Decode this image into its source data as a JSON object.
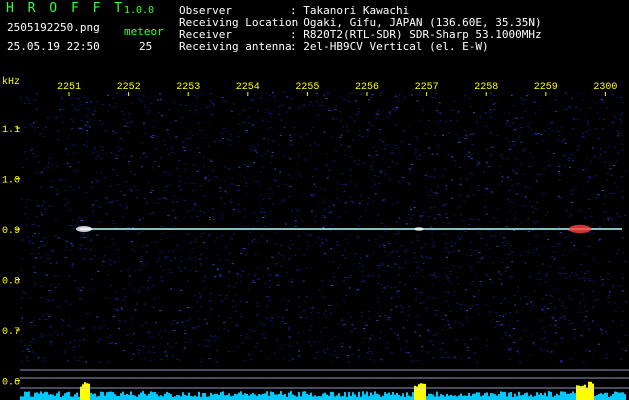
{
  "header": {
    "app_name": "H R O F F T",
    "version": "1.0.0",
    "filename": "2505192250.png",
    "datetime": "25.05.19 22:50",
    "meteor_label": "meteor",
    "meteor_count": "25"
  },
  "station": {
    "observer_label": "Observer",
    "observer_value": ": Takanori Kawachi",
    "location_label": "Receiving Location",
    "location_value": ": Ogaki, Gifu, JAPAN (136.60E, 35.35N)",
    "receiver_label": "Receiver",
    "receiver_value": ": R820T2(RTL-SDR) SDR-Sharp 53.1000MHz",
    "antenna_label": "Receiving antenna",
    "antenna_value": ": 2el-HB9CV Vertical (el. E-W)"
  },
  "axis": {
    "unit": "kHz",
    "time_ticks": [
      "2251",
      "2252",
      "2253",
      "2254",
      "2255",
      "2256",
      "2257",
      "2258",
      "2259",
      "2300"
    ],
    "freq_ticks": [
      "1.1",
      "1.0",
      "0.9",
      "0.8",
      "0.7",
      "0.6"
    ]
  },
  "colors": {
    "background": "#000000",
    "label_green": "#33ff33",
    "label_yellow": "#ffff00",
    "waterfall_noise": "#1a2bd0",
    "carrier": "#b0ffff",
    "meteor_peak": "#ff4040",
    "signal_bar": "#00c8ff"
  },
  "chart_data": {
    "type": "heatmap",
    "x_unit": "time (HHMM)",
    "y_unit": "kHz",
    "x_categories": [
      "2251",
      "2252",
      "2253",
      "2254",
      "2255",
      "2256",
      "2257",
      "2258",
      "2259",
      "2300"
    ],
    "y_ticks": [
      1.1,
      1.0,
      0.9,
      0.8,
      0.7,
      0.6
    ],
    "ylim": [
      0.58,
      1.2
    ],
    "carrier_freq_khz": 0.9,
    "strong_echo_times": [
      "2251",
      "2256.8",
      "2259.6"
    ]
  }
}
